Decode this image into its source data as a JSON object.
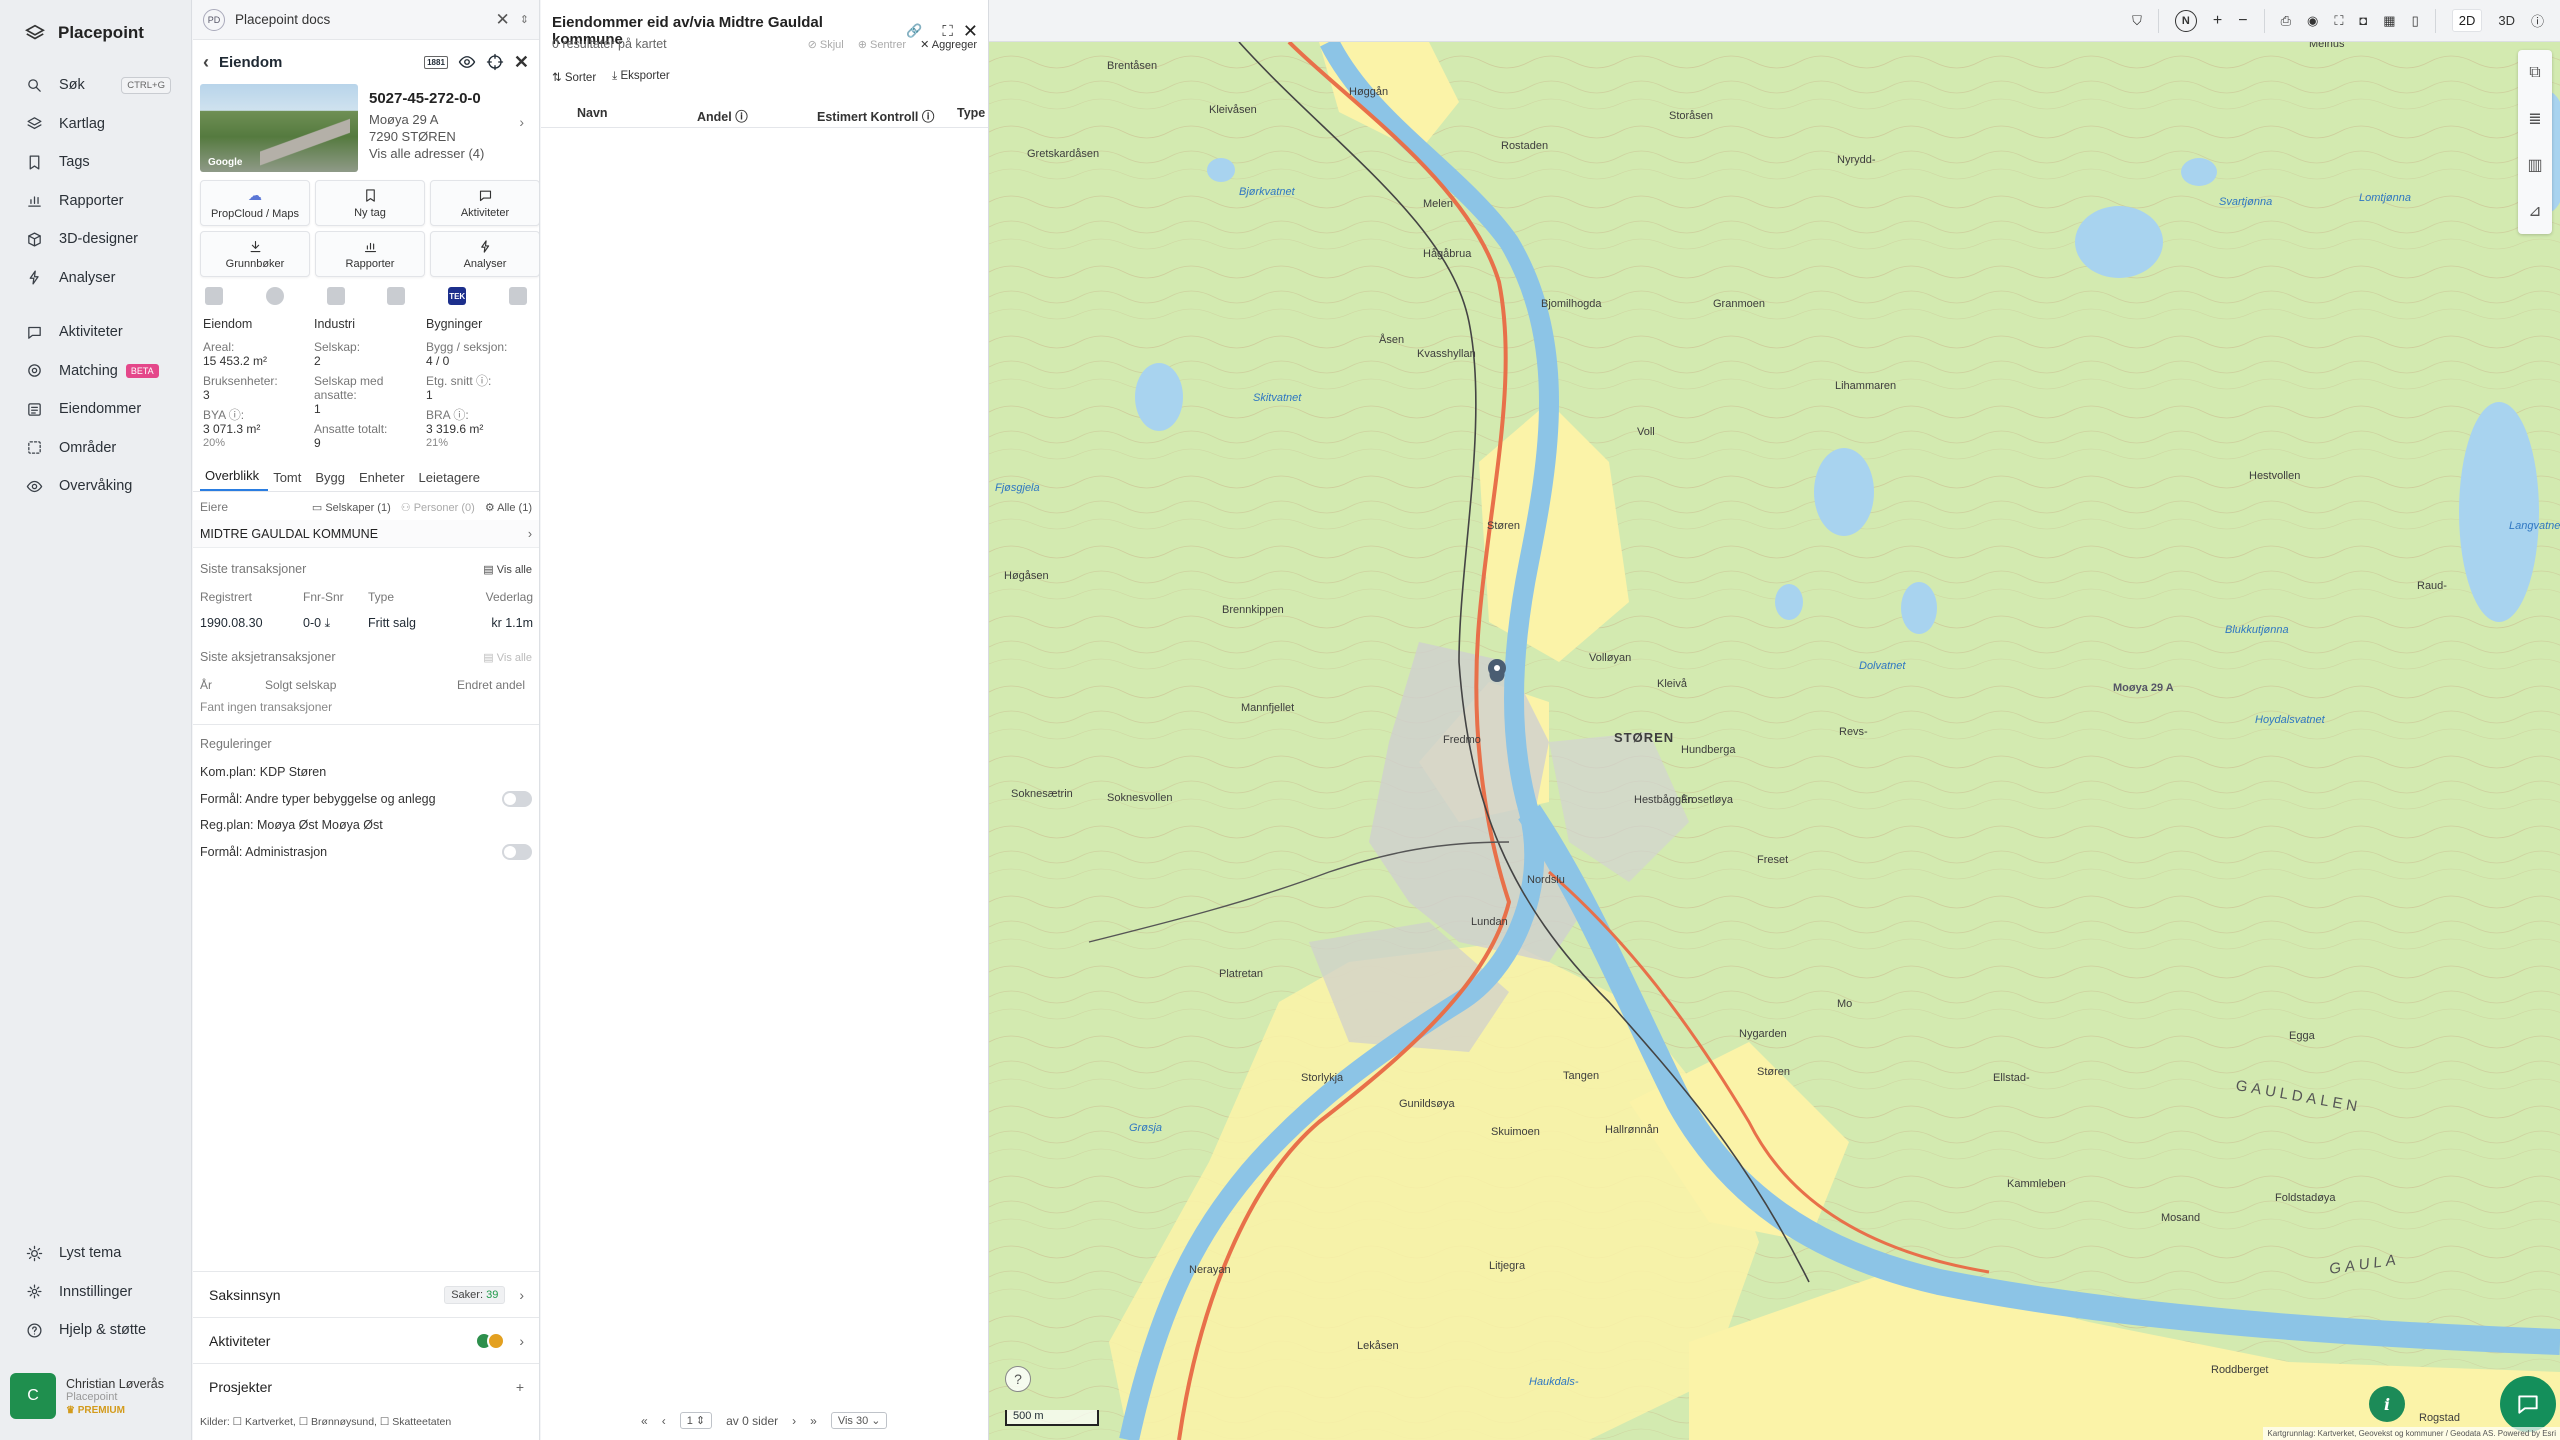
{
  "nav": {
    "brand": "Placepoint",
    "items": [
      {
        "label": "Søk",
        "icon": "search-icon",
        "shortcut": "CTRL+G"
      },
      {
        "label": "Kartlag",
        "icon": "layers-icon"
      },
      {
        "label": "Tags",
        "icon": "bookmark-icon"
      },
      {
        "label": "Rapporter",
        "icon": "bar-chart-icon"
      },
      {
        "label": "3D-designer",
        "icon": "cube-icon"
      },
      {
        "label": "Analyser",
        "icon": "bolt-icon"
      }
    ],
    "items2": [
      {
        "label": "Aktiviteter",
        "icon": "chat-icon"
      },
      {
        "label": "Matching",
        "icon": "target-icon",
        "badge": "BETA"
      },
      {
        "label": "Eiendommer",
        "icon": "list-icon"
      },
      {
        "label": "Områder",
        "icon": "area-icon"
      },
      {
        "label": "Overvåking",
        "icon": "eye-icon"
      }
    ],
    "bottom": [
      {
        "label": "Lyst tema",
        "icon": "sun-icon"
      },
      {
        "label": "Innstillinger",
        "icon": "gear-icon"
      },
      {
        "label": "Hjelp & støtte",
        "icon": "help-icon"
      }
    ],
    "user": {
      "initial": "C",
      "name": "Christian Løverås",
      "org": "Placepoint",
      "plan": "PREMIUM"
    }
  },
  "doc_tab": {
    "badge": "PD",
    "title": "Placepoint docs"
  },
  "property": {
    "header": "Eiendom",
    "header_badge": "1881",
    "image_credit": "Google",
    "id": "5027-45-272-0-0",
    "address_line1": "Moøya 29 A",
    "address_line2": "7290 STØREN",
    "all_addresses": "Vis alle adresser (4)",
    "tiles": [
      {
        "label": "PropCloud / Maps",
        "icon": "cloud-icon"
      },
      {
        "label": "Ny tag",
        "icon": "bookmark-icon"
      },
      {
        "label": "Aktiviteter",
        "icon": "chat-icon"
      },
      {
        "label": "Grunnbøker",
        "icon": "download-icon"
      },
      {
        "label": "Rapporter",
        "icon": "bar-chart-icon"
      },
      {
        "label": "Analyser",
        "icon": "bolt-icon"
      }
    ],
    "source_tek": "TEK",
    "stats": {
      "col1": {
        "title": "Eiendom",
        "areal_lbl": "Areal:",
        "areal": "15 453.2 m²",
        "bruks_lbl": "Bruksenheter:",
        "bruks": "3",
        "bya_lbl": "BYA ⓘ:",
        "bya": "3 071.3 m²",
        "bya_pct": "20%"
      },
      "col2": {
        "title": "Industri",
        "selskap_lbl": "Selskap:",
        "selskap": "2",
        "ansatte_lbl": "Selskap med ansatte:",
        "ansatte": "1",
        "tot_lbl": "Ansatte totalt:",
        "tot": "9"
      },
      "col3": {
        "title": "Bygninger",
        "bygg_lbl": "Bygg / seksjon:",
        "bygg": "4 / 0",
        "etg_lbl": "Etg. snitt ⓘ:",
        "etg": "1",
        "bra_lbl": "BRA ⓘ:",
        "bra": "3 319.6 m²",
        "bra_pct": "21%"
      }
    },
    "tabs": [
      "Overblikk",
      "Tomt",
      "Bygg",
      "Enheter",
      "Leietagere"
    ],
    "owners": {
      "label": "Eiere",
      "companies": "Selskaper (1)",
      "persons": "Personer (0)",
      "all": "Alle (1)",
      "owner": "MIDTRE GAULDAL KOMMUNE"
    },
    "transactions": {
      "title": "Siste transaksjoner",
      "show_all": "Vis alle",
      "headers": [
        "Registrert",
        "Fnr-Snr",
        "Type",
        "Vederlag"
      ],
      "rows": [
        [
          "1990.08.30",
          "0-0",
          "Fritt salg",
          "kr 1.1m"
        ]
      ]
    },
    "share_tx": {
      "title": "Siste aksjetransaksjoner",
      "show_all": "Vis alle",
      "headers": [
        "År",
        "Solgt selskap",
        "Endret andel"
      ],
      "empty": "Fant ingen transaksjoner"
    },
    "regulations": {
      "title": "Reguleringer",
      "lines": [
        {
          "text": "Kom.plan: KDP Støren",
          "toggle": false
        },
        {
          "text": "Formål: Andre typer bebyggelse og anlegg",
          "toggle": true
        },
        {
          "text": "Reg.plan: Moøya Øst Moøya Øst",
          "toggle": false
        },
        {
          "text": "Formål: Administrasjon",
          "toggle": true
        }
      ]
    },
    "accordions": {
      "saksinnsyn": "Saksinnsyn",
      "cases_label": "Saker:",
      "cases_count": "39",
      "aktiviteter": "Aktiviteter",
      "prosjekter": "Prosjekter"
    },
    "sources": "Kilder: ☐ Kartverket, ☐ Brønnøysund, ☐ Skatteetaten"
  },
  "list": {
    "title": "Eiendommer eid av/via Midtre Gauldal kommune",
    "result_count": "0 resultater på kartet",
    "actions": {
      "hide": "Skjul",
      "center": "Sentrer",
      "aggregate": "Aggreger"
    },
    "tools": {
      "sort": "Sorter",
      "export": "Eksporter"
    },
    "columns": [
      "Navn",
      "Andel ⓘ",
      "Estimert Kontroll ⓘ",
      "Type"
    ],
    "pager": {
      "page": "1",
      "of_pages": "av 0 sider",
      "per_page": "Vis 30"
    }
  },
  "topbar": {
    "north": "N",
    "mode_2d": "2D",
    "mode_3d": "3D"
  },
  "map": {
    "scale": "500 m",
    "attribution": "Kartgrunnlag: Kartverket, Geovekst og kommuner / Geodata AS. Powered by Esri",
    "labels": {
      "storen": "STØREN",
      "gauldalen": "GAULDALEN",
      "gaula": "GAULA",
      "marker": "Moøya 29 A",
      "places": [
        "Brentåsen",
        "Høggån",
        "Melhus",
        "Kleivåsen",
        "Gretskardåsen",
        "Rostaden",
        "Storåsen",
        "Nyrydd-",
        "Melen",
        "Bjørkvatnet",
        "Hågåbrua",
        "Bjomilhogda",
        "Granmoen",
        "Åsen",
        "Lihammaren",
        "Kvasshyllan",
        "Voll",
        "Støren",
        "Høgåsen",
        "Brennkippen",
        "Volløyan",
        "Kleivå",
        "Mannfjellet",
        "Hundberga",
        "Revs-",
        "Fredmo",
        "Hestbåggån",
        "Soknesætrin",
        "Soknesvollen",
        "Frosetløya",
        "Freset",
        "Nordslu",
        "Lundan",
        "Platretan",
        "Mo",
        "Støren",
        "Nygarden",
        "Ellstad-",
        "Egga",
        "Storlykja",
        "Tangen",
        "Gunildsøya",
        "Hallrønnån",
        "Skuimoen",
        "Kammleben",
        "Mosand",
        "Foldstadøya",
        "Litjegra",
        "Nerayan",
        "Lekåsen",
        "Roddberget",
        "Rogstad",
        "Raud-",
        "Hestvollen"
      ],
      "water": [
        "Skitvatnet",
        "Fjøsgjela",
        "Svartjønna",
        "Lomtjønna",
        "Dolvatnet",
        "Blukkutjønna",
        "Hoydalsvatnet",
        "Langvatnet",
        "Grøsja",
        "Haukdals-"
      ]
    }
  },
  "colors": {
    "accent": "#2a7de1",
    "brand_green": "#148f5b",
    "beta": "#e4478a",
    "map_base": "#d6ebb4",
    "road": "#e8704a",
    "river": "#8cc4e6",
    "field": "#fbf3a8"
  }
}
